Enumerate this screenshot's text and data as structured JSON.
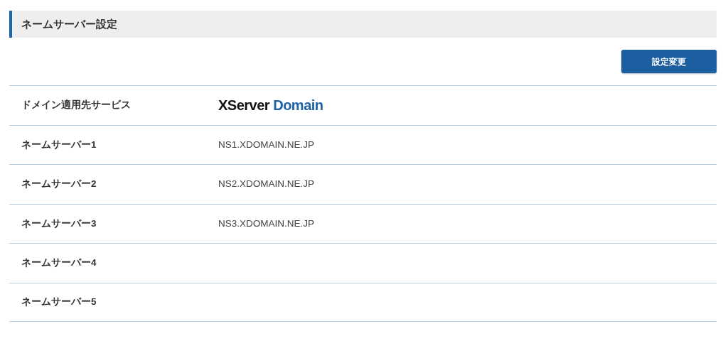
{
  "section": {
    "title": "ネームサーバー設定"
  },
  "buttons": [
    "設定変更"
  ],
  "rows": [
    {
      "label": "ドメイン適用先サービス",
      "kind": "logo",
      "logo": {
        "primary": "XServer",
        "accent": "Domain"
      }
    },
    {
      "label": "ネームサーバー1",
      "kind": "text",
      "value": "NS1.XDOMAIN.NE.JP"
    },
    {
      "label": "ネームサーバー2",
      "kind": "text",
      "value": "NS2.XDOMAIN.NE.JP"
    },
    {
      "label": "ネームサーバー3",
      "kind": "text",
      "value": "NS3.XDOMAIN.NE.JP"
    },
    {
      "label": "ネームサーバー4",
      "kind": "text"
    },
    {
      "label": "ネームサーバー5",
      "kind": "text"
    }
  ]
}
